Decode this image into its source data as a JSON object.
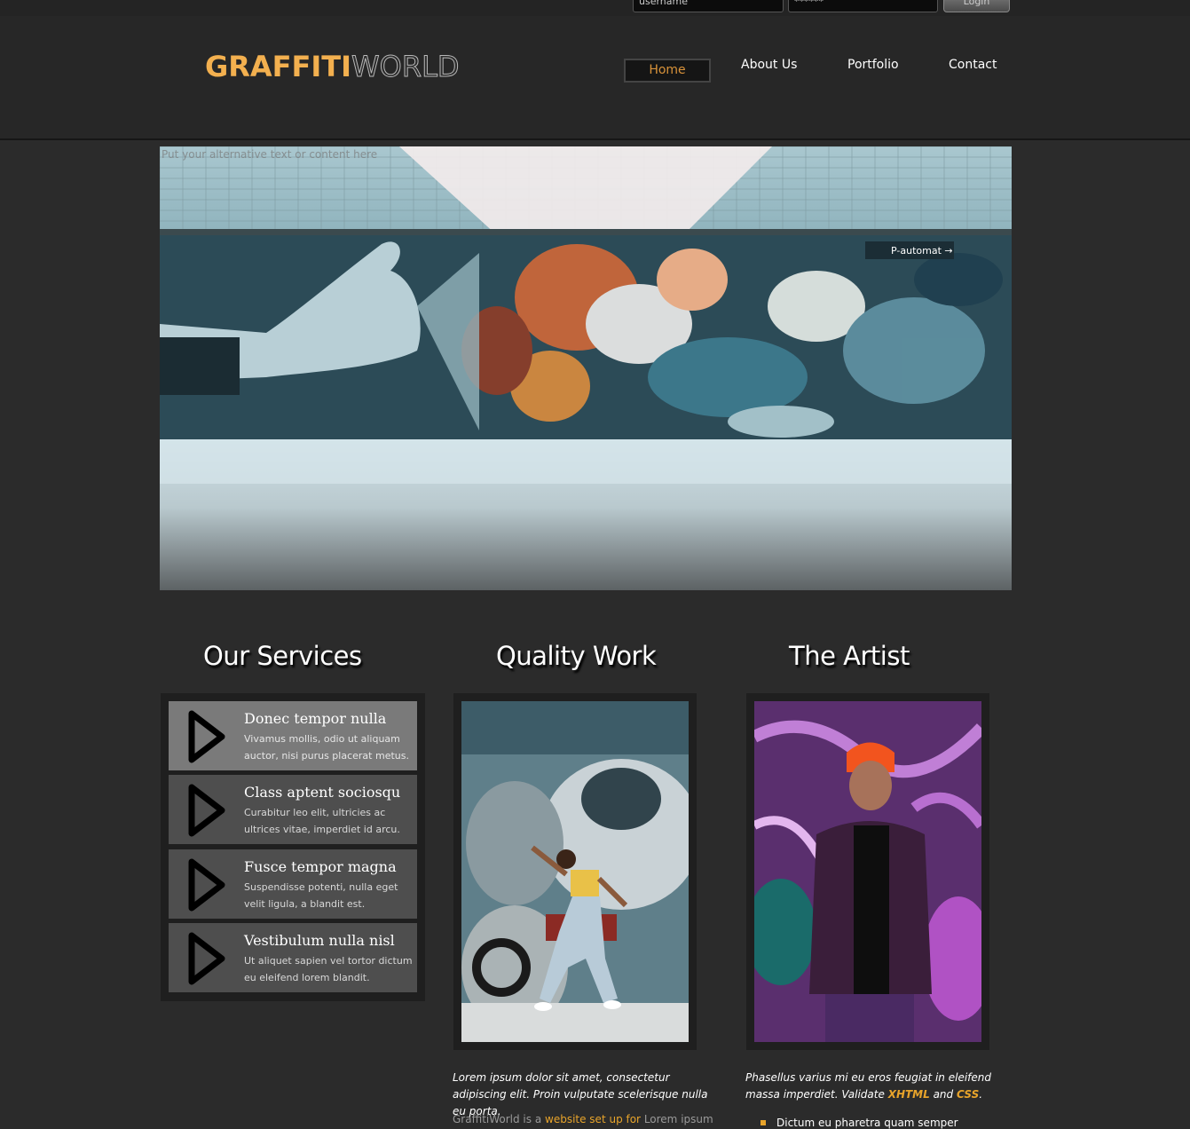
{
  "login": {
    "username_placeholder": "username",
    "password_value": "******",
    "login_label": "Login"
  },
  "logo": {
    "part1": "GRAFFITI",
    "part2": "WORLD"
  },
  "nav": [
    {
      "label": "Home",
      "active": true
    },
    {
      "label": "About Us"
    },
    {
      "label": "Portfolio"
    },
    {
      "label": "Contact"
    }
  ],
  "hero": {
    "alt_text": "Put your alternative text or content here"
  },
  "sections": {
    "services_title": "Our Services",
    "quality_title": "Quality Work",
    "artist_title": "The Artist"
  },
  "services": [
    {
      "title": "Donec tempor nulla",
      "text": "Vivamus mollis, odio ut aliquam auctor, nisi purus placerat metus."
    },
    {
      "title": "Class aptent sociosqu",
      "text": "Curabitur leo elit, ultricies ac ultrices vitae, imperdiet id arcu."
    },
    {
      "title": "Fusce tempor magna",
      "text": "Suspendisse potenti, nulla eget velit ligula, a blandit est."
    },
    {
      "title": "Vestibulum nulla nisl",
      "text": "Ut aliquet sapien vel tortor dictum eu eleifend lorem blandit."
    }
  ],
  "quality": {
    "italic": "Lorem ipsum dolor sit amet, consectetur adipiscing elit. Proin vulputate scelerisque nulla eu porta.",
    "small_prefix": "GraffitiWorld is a ",
    "small_link": "website set up for",
    "small_suffix": " Lorem ipsum"
  },
  "artist": {
    "italic_prefix": "Phasellus varius mi eu eros feugiat in eleifend massa imperdiet. Validate ",
    "xhtml": "XHTML",
    "and": " and ",
    "css": "CSS",
    "period": ".",
    "bullet": "Dictum eu pharetra quam semper"
  },
  "colors": {
    "accent": "#e8a42b",
    "background": "#2b2b2b",
    "nav_active": "#d8923a"
  },
  "icons": {
    "service_arrow": "play-arrow-icon"
  }
}
